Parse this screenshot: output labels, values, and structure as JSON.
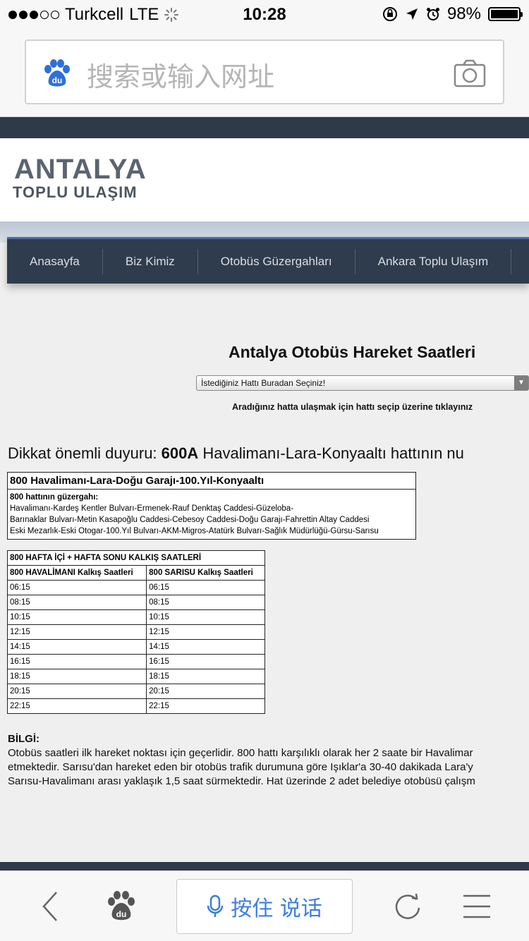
{
  "status_bar": {
    "carrier": "Turkcell",
    "network": "LTE",
    "time": "10:28",
    "battery": "98%"
  },
  "browser": {
    "search_placeholder": "搜索或输入网址",
    "voice_label": "按住 说话"
  },
  "site": {
    "logo_main": "ANTALYA",
    "logo_sub": "TOPLU ULAŞIM",
    "nav": [
      "Anasayfa",
      "Biz Kimiz",
      "Otobüs Güzergahları",
      "Ankara Toplu Ulaşım"
    ],
    "page_title": "Antalya Otobüs Hareket Saatleri",
    "select_value": "İstediğiniz Hattı Buradan Seçiniz!",
    "select_hint": "Aradığınız hatta ulaşmak için hattı seçip üzerine tıklayınız",
    "notice_prefix": "Dikkat önemli duyuru: ",
    "notice_bold": "600A",
    "notice_rest": " Havalimanı-Lara-Konyaaltı hattının nu"
  },
  "route": {
    "title": "800 Havalimanı-Lara-Doğu Garajı-100.Yıl-Konyaaltı",
    "heading": "800 hattının güzergahı:",
    "lines": [
      "Havalimanı-Kardeş Kentler Bulvarı-Ermenek-Rauf Denktaş Caddesi-Güzeloba-",
      "Barınaklar Bulvarı-Metin Kasapoğlu Caddesi-Cebesoy Caddesi-Doğu Garajı-Fahrettin Altay Caddesi",
      "Eski Mezarlık-Eski Otogar-100.Yıl Bulvarı-AKM-Migros-Atatürk Bulvarı-Sağlık Müdürlüğü-Gürsu-Sarısu"
    ]
  },
  "schedule": {
    "title": "800 HAFTA İÇİ + HAFTA SONU KALKIŞ SAATLERİ",
    "col1": "800 HAVALİMANI Kalkış Saatleri",
    "col2": "800 SARISU Kalkış Saatleri",
    "rows": [
      [
        "06:15",
        "06:15"
      ],
      [
        "08:15",
        "08:15"
      ],
      [
        "10:15",
        "10:15"
      ],
      [
        "12:15",
        "12:15"
      ],
      [
        "14:15",
        "14:15"
      ],
      [
        "16:15",
        "16:15"
      ],
      [
        "18:15",
        "18:15"
      ],
      [
        "20:15",
        "20:15"
      ],
      [
        "22:15",
        "22:15"
      ]
    ]
  },
  "info": {
    "heading": "BİLGİ:",
    "lines": [
      "Otobüs saatleri ilk hareket noktası için geçerlidir. 800 hattı karşılıklı olarak her 2 saate bir Havalimar",
      "etmektedir. Sarısu'dan hareket eden bir otobüs trafik durumuna göre Işıklar'a 30-40 dakikada Lara'y",
      "Sarısu-Havalimanı arası yaklaşık 1,5 saat sürmektedir. Hat üzerinde 2 adet belediye otobüsü çalışm"
    ]
  }
}
